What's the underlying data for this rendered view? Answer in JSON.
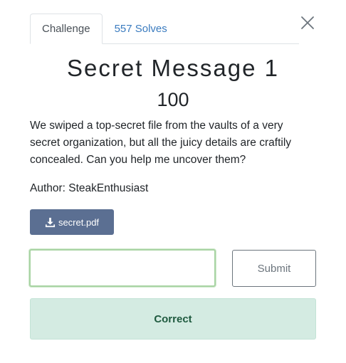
{
  "tabs": [
    {
      "label": "Challenge",
      "active": true
    },
    {
      "label": "557 Solves",
      "active": false
    }
  ],
  "close_icon": "close-icon",
  "challenge": {
    "name": "Secret Message 1",
    "points": "100",
    "description": "We swiped a top-secret file from the vaults of a very secret organization, but all the juicy details are craftily concealed. Can you help me uncover them?",
    "author": "Author: SteakEnthusiast"
  },
  "file": {
    "name": "secret.pdf",
    "icon": "download-icon"
  },
  "flag_form": {
    "input_value": "",
    "input_placeholder": "",
    "submit_label": "Submit"
  },
  "result": {
    "message": "Correct"
  },
  "colors": {
    "tab_link": "#3a7bbf",
    "download_button_bg": "#5b6f92",
    "input_border_success": "#a9d4a4",
    "result_bg": "#d4ebe2",
    "result_text": "#1f5a3f"
  }
}
